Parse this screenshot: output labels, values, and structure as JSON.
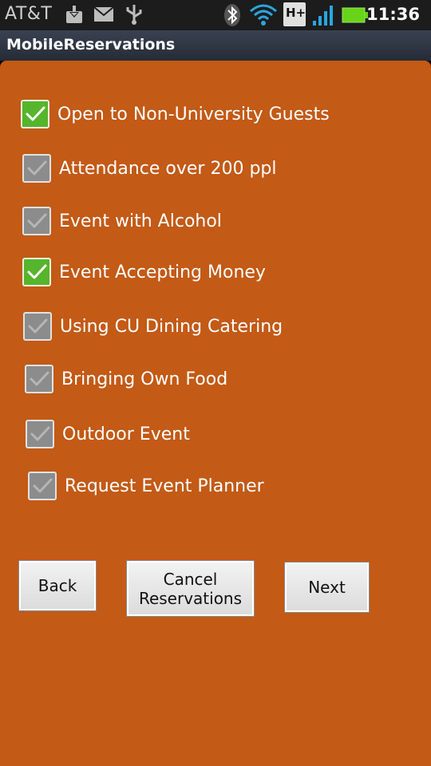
{
  "status_bar": {
    "carrier": "AT&T",
    "network_label": "H+",
    "time": "11:36",
    "icons": [
      "download-icon",
      "mail-icon",
      "usb-icon",
      "bluetooth-icon",
      "wifi-icon",
      "network-h-plus-icon",
      "signal-icon",
      "battery-icon"
    ]
  },
  "app": {
    "title": "MobileReservations"
  },
  "options": [
    {
      "label": "Open to Non-University Guests",
      "checked": true
    },
    {
      "label": "Attendance over 200 ppl",
      "checked": false
    },
    {
      "label": "Event with Alcohol",
      "checked": false
    },
    {
      "label": "Event Accepting Money",
      "checked": true
    },
    {
      "label": "Using CU Dining Catering",
      "checked": false
    },
    {
      "label": "Bringing Own Food",
      "checked": false
    },
    {
      "label": "Outdoor Event",
      "checked": false
    },
    {
      "label": "Request Event Planner",
      "checked": false
    }
  ],
  "buttons": {
    "back": "Back",
    "cancel_line1": "Cancel",
    "cancel_line2": "Reservations",
    "next": "Next"
  },
  "colors": {
    "background": "#c35a16",
    "checked": "#56b52c",
    "unchecked": "#8c8c8c"
  }
}
